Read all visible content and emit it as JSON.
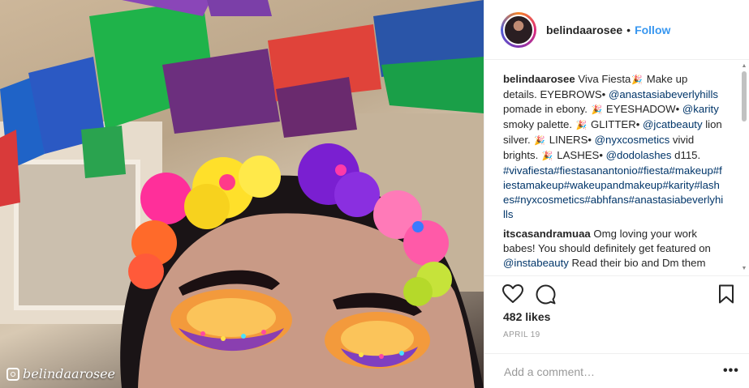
{
  "post": {
    "username": "belindaarosee",
    "follow_label": "Follow",
    "watermark": "belindaarosee",
    "caption": {
      "username": "belindaarosee",
      "segments": [
        {
          "t": "text",
          "v": " Viva Fiesta"
        },
        {
          "t": "emoji",
          "v": "🎉"
        },
        {
          "t": "text",
          "v": " Make up details. EYEBROWS• "
        },
        {
          "t": "link",
          "v": "@anastasiabeverlyhills"
        },
        {
          "t": "text",
          "v": " pomade in ebony. "
        },
        {
          "t": "emoji",
          "v": "🎉"
        },
        {
          "t": "text",
          "v": " EYESHADOW• "
        },
        {
          "t": "link",
          "v": "@karity"
        },
        {
          "t": "text",
          "v": " smoky palette. "
        },
        {
          "t": "emoji",
          "v": "🎉"
        },
        {
          "t": "text",
          "v": " GLITTER• "
        },
        {
          "t": "link",
          "v": "@jcatbeauty"
        },
        {
          "t": "text",
          "v": " lion silver. "
        },
        {
          "t": "emoji",
          "v": "🎉"
        },
        {
          "t": "text",
          "v": " LINERS• "
        },
        {
          "t": "link",
          "v": "@nyxcosmetics"
        },
        {
          "t": "text",
          "v": " vivid brights. "
        },
        {
          "t": "emoji",
          "v": "🎉"
        },
        {
          "t": "text",
          "v": " LASHES• "
        },
        {
          "t": "link",
          "v": "@dodolashes"
        },
        {
          "t": "text",
          "v": " d115. "
        },
        {
          "t": "link",
          "v": "#vivafiesta#fiestasanantonio#fiesta#makeup#fiestamakeup#wakeupandmakeup#karity#lashes#nyxcosmetics#abhfans#anastasiabeverlyhills"
        }
      ]
    },
    "comment2": {
      "username": "itscasandramuaa",
      "segments": [
        {
          "t": "text",
          "v": " Omg loving your work babes! You should definitely get featured on "
        },
        {
          "t": "link",
          "v": "@instabeauty"
        },
        {
          "t": "text",
          "v": " Read their bio and Dm them"
        }
      ]
    },
    "likes": "482 likes",
    "date": "APRIL 19",
    "add_comment_placeholder": "Add a comment…",
    "more_label": "•••"
  },
  "icons": {
    "like": "heart-icon",
    "comment": "comment-icon",
    "save": "bookmark-icon",
    "watermark": "instagram-icon"
  }
}
